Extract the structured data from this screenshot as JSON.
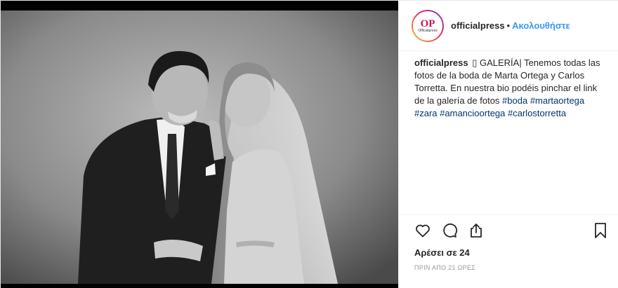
{
  "post": {
    "username": "officialpress",
    "separator": "•",
    "follow_label": "Ακολουθήστε",
    "avatar": {
      "monogram": "OP",
      "subtitle": "Officialpress"
    },
    "photo": {
      "description_icon": "wedding-photo"
    },
    "caption": {
      "username": "officialpress",
      "text": " ▯ GALERÍA| Tenemos todas las fotos de la boda de Marta Ortega y Carlos Torretta. En nuestra bio podéis pinchar el link de la galería de fotos ",
      "hashtags": [
        "#boda",
        "#martaortega",
        "#zara",
        "#amancioortega",
        "#carlostorretta"
      ]
    },
    "actions": {
      "icons": [
        "heart-icon",
        "comment-icon",
        "share-icon",
        "bookmark-icon"
      ],
      "likes_label": "Αρέσει σε 24",
      "time_label": "ΠΡΙΝ ΑΠΟ 21 ΩΡΕΣ"
    },
    "colors": {
      "link": "#3897f0",
      "hashtag": "#003569",
      "muted": "#999999"
    }
  }
}
